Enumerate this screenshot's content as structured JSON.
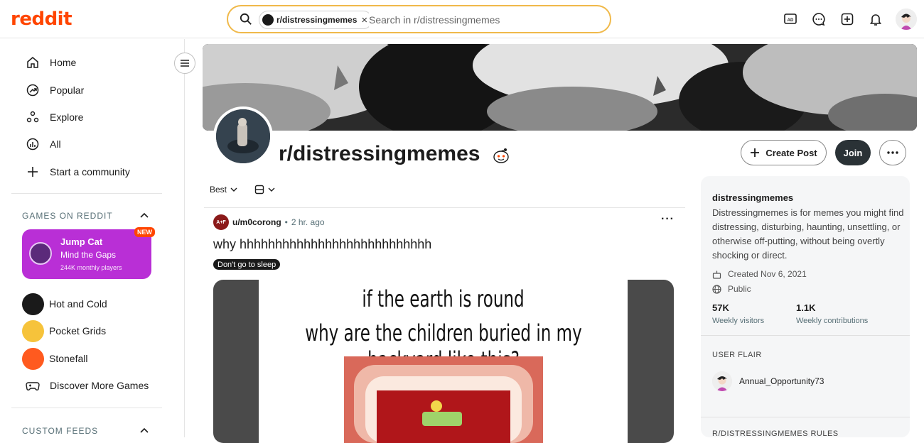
{
  "topbar": {
    "logo": "reddit",
    "search_chip": "r/distressingmemes",
    "search_placeholder": "Search in r/distressingmemes",
    "icons": [
      "advertise-icon",
      "chat-icon",
      "create-icon",
      "notifications-icon",
      "user-avatar"
    ]
  },
  "sidebar": {
    "nav": [
      {
        "label": "Home",
        "icon": "home-icon"
      },
      {
        "label": "Popular",
        "icon": "popular-icon"
      },
      {
        "label": "Explore",
        "icon": "explore-icon"
      },
      {
        "label": "All",
        "icon": "all-icon"
      },
      {
        "label": "Start a community",
        "icon": "plus-icon"
      }
    ],
    "games_header": "GAMES ON REDDIT",
    "featured_game": {
      "title": "Jump Cat",
      "subtitle": "Mind the Gaps",
      "players": "244K monthly players",
      "badge": "NEW"
    },
    "games": [
      {
        "label": "Hot and Cold",
        "color": "#1a1a1a"
      },
      {
        "label": "Pocket Grids",
        "color": "#f6c33b"
      },
      {
        "label": "Stonefall",
        "color": "#ff5a1f"
      }
    ],
    "discover": "Discover More Games",
    "custom_feeds_header": "CUSTOM FEEDS"
  },
  "subreddit": {
    "title": "r/distressingmemes",
    "create_post": "Create Post",
    "join": "Join"
  },
  "feed": {
    "sort": "Best",
    "post": {
      "avatar_text": "A+F",
      "author": "u/m0corong",
      "time": "2 hr. ago",
      "title": "why hhhhhhhhhhhhhhhhhhhhhhhhhhh",
      "flair": "Don't go to sleep",
      "meme_line1": "if the earth is round",
      "meme_line2": "why are the children buried in my backyard like this?"
    }
  },
  "about": {
    "name": "distressingmemes",
    "description": "Distressingmemes is for memes you might find distressing, disturbing, haunting, unsettling, or otherwise off-putting, without being overtly shocking or direct.",
    "created": "Created Nov 6, 2021",
    "visibility": "Public",
    "visitors_value": "57K",
    "visitors_label": "Weekly visitors",
    "contributions_value": "1.1K",
    "contributions_label": "Weekly contributions",
    "user_flair_header": "USER FLAIR",
    "username": "Annual_Opportunity73",
    "rules_header": "R/DISTRESSINGMEMES RULES"
  },
  "colors": {
    "brand": "#ff4500",
    "search_border": "#f0b94a",
    "join_button": "#2a3236",
    "jumpcat_bg": "#b92fd6"
  }
}
